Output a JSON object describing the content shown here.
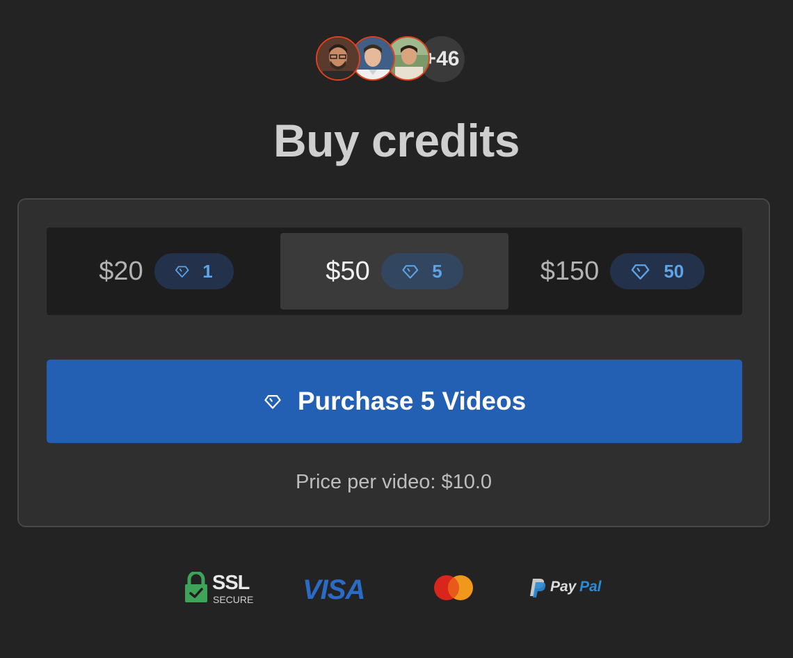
{
  "social_proof": {
    "avatars": [
      "user-avatar-1",
      "user-avatar-2",
      "user-avatar-3"
    ],
    "more_count": "+46"
  },
  "title": "Buy credits",
  "options": [
    {
      "price": "$20",
      "credits": "1",
      "selected": false
    },
    {
      "price": "$50",
      "credits": "5",
      "selected": true
    },
    {
      "price": "$150",
      "credits": "50",
      "selected": false
    }
  ],
  "purchase": {
    "label": "Purchase 5 Videos"
  },
  "price_per_video": "Price per video: $10.0",
  "payment_logos": {
    "ssl_main": "SSL",
    "ssl_sub": "SECURE",
    "visa": "VISA",
    "mastercard": "mastercard-logo",
    "paypal_1": "Pay",
    "paypal_2": "Pal"
  },
  "colors": {
    "background": "#232323",
    "card": "#2f2f2f",
    "accent": "#2360b4",
    "badge_text": "#5ea4e8"
  }
}
